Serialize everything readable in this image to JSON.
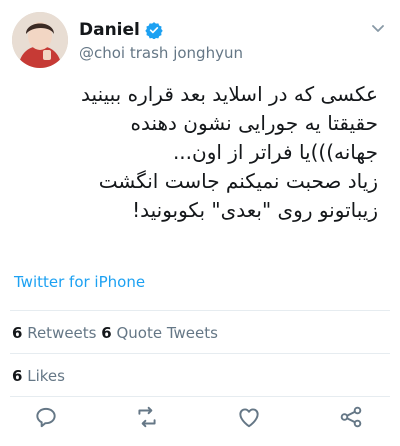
{
  "author": {
    "display_name": "Daniel",
    "handle": "@choi trash jonghyun",
    "verified": true
  },
  "tweet": {
    "lines": [
      "عکسی که در اسلاید بعد قراره ببینید",
      "حقیقتا یه جورایی نشون دهنده",
      "جهانه)))یا فراتر از اون...",
      "زیاد صحبت نمیکنم جاست انگشت",
      "زیباتونو روی \"بعدی\" بکوبونید!"
    ],
    "source": "Twitter for iPhone"
  },
  "stats": {
    "retweets_count": "6",
    "retweets_label": " Retweets ",
    "quote_count": "6",
    "quote_label": " Quote Tweets",
    "likes_count": "6",
    "likes_label": " Likes"
  },
  "icons": {
    "verified": "verified-badge-icon",
    "more": "chevron-down-icon",
    "reply": "reply-icon",
    "retweet": "retweet-icon",
    "like": "heart-icon",
    "share": "share-icon"
  },
  "colors": {
    "accent": "#1da1f2",
    "secondary": "#657786",
    "divider": "#e6ecf0",
    "text": "#14171a"
  }
}
